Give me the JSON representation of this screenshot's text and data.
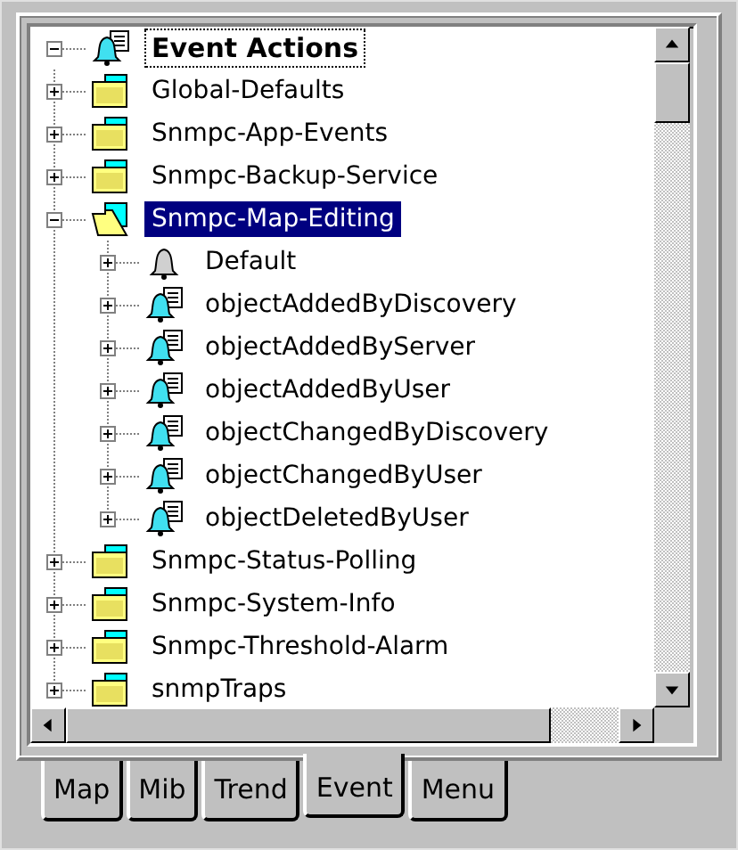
{
  "tree": {
    "label": "Event Actions",
    "kind": "bell-doc",
    "expanded": true,
    "selected": false,
    "focused": true,
    "children": [
      {
        "label": "Global-Defaults",
        "kind": "folder",
        "expanded": false,
        "selected": false,
        "focused": false
      },
      {
        "label": "Snmpc-App-Events",
        "kind": "folder",
        "expanded": false,
        "selected": false,
        "focused": false
      },
      {
        "label": "Snmpc-Backup-Service",
        "kind": "folder",
        "expanded": false,
        "selected": false,
        "focused": false
      },
      {
        "label": "Snmpc-Map-Editing",
        "kind": "folder",
        "expanded": true,
        "selected": true,
        "focused": false,
        "children": [
          {
            "label": "Default",
            "kind": "bell",
            "expanded": false,
            "selected": false,
            "focused": false
          },
          {
            "label": "objectAddedByDiscovery",
            "kind": "bell-doc",
            "expanded": false,
            "selected": false,
            "focused": false
          },
          {
            "label": "objectAddedByServer",
            "kind": "bell-doc",
            "expanded": false,
            "selected": false,
            "focused": false
          },
          {
            "label": "objectAddedByUser",
            "kind": "bell-doc",
            "expanded": false,
            "selected": false,
            "focused": false
          },
          {
            "label": "objectChangedByDiscovery",
            "kind": "bell-doc",
            "expanded": false,
            "selected": false,
            "focused": false
          },
          {
            "label": "objectChangedByUser",
            "kind": "bell-doc",
            "expanded": false,
            "selected": false,
            "focused": false
          },
          {
            "label": "objectDeletedByUser",
            "kind": "bell-doc",
            "expanded": false,
            "selected": false,
            "focused": false
          }
        ]
      },
      {
        "label": "Snmpc-Status-Polling",
        "kind": "folder",
        "expanded": false,
        "selected": false,
        "focused": false
      },
      {
        "label": "Snmpc-System-Info",
        "kind": "folder",
        "expanded": false,
        "selected": false,
        "focused": false
      },
      {
        "label": "Snmpc-Threshold-Alarm",
        "kind": "folder",
        "expanded": false,
        "selected": false,
        "focused": false
      },
      {
        "label": "snmpTraps",
        "kind": "folder",
        "expanded": false,
        "selected": false,
        "focused": false
      }
    ]
  },
  "tabs": [
    {
      "label": "Map",
      "selected": false
    },
    {
      "label": "Mib",
      "selected": false
    },
    {
      "label": "Trend",
      "selected": false
    },
    {
      "label": "Event",
      "selected": true
    },
    {
      "label": "Menu",
      "selected": false
    }
  ]
}
